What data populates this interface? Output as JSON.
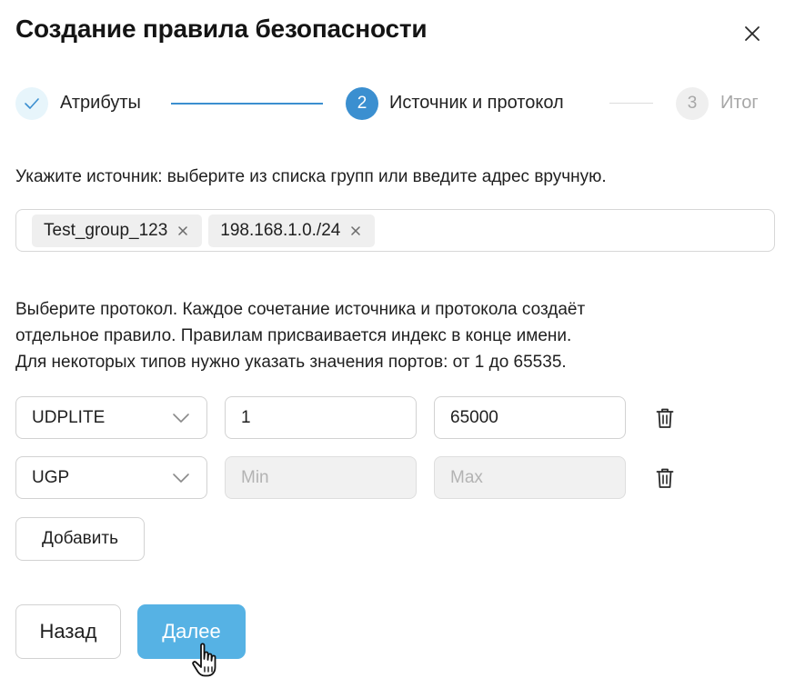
{
  "dialog": {
    "title": "Создание правила безопасности",
    "close_icon": "close-icon"
  },
  "stepper": {
    "steps": [
      {
        "number": "",
        "label": "Атрибуты",
        "state": "done",
        "icon": "check-icon"
      },
      {
        "number": "2",
        "label": "Источник и протокол",
        "state": "active"
      },
      {
        "number": "3",
        "label": "Итог",
        "state": "pending"
      }
    ],
    "colors": {
      "active": "#3b8fd0",
      "done_bg": "#e7f5fb",
      "pending_bg": "#efefef"
    }
  },
  "source": {
    "hint": "Укажите источник: выберите из списка групп или введите адрес вручную.",
    "chips": [
      "Test_group_123",
      "198.168.1.0./24"
    ]
  },
  "protocol": {
    "hint_lines": [
      "Выберите протокол. Каждое сочетание источника и протокола создаёт",
      "отдельное правило. Правилам присваивается индекс в конце имени.",
      "Для некоторых типов нужно указать значения портов: от 1 до 65535."
    ],
    "rows": [
      {
        "protocol": "UDPLITE",
        "min_value": "1",
        "max_value": "65000",
        "min_placeholder": "Min",
        "max_placeholder": "Max",
        "ports_enabled": true
      },
      {
        "protocol": "UGP",
        "min_value": "",
        "max_value": "",
        "min_placeholder": "Min",
        "max_placeholder": "Max",
        "ports_enabled": false
      }
    ],
    "add_label": "Добавить"
  },
  "footer": {
    "back_label": "Назад",
    "next_label": "Далее",
    "next_color": "#56b2e4"
  }
}
